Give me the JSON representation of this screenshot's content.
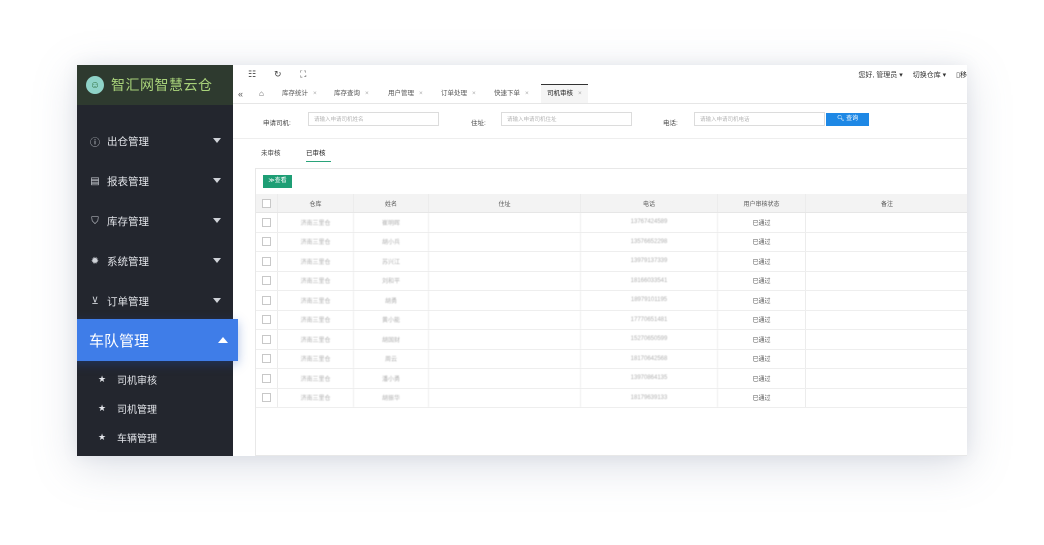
{
  "brand": {
    "name": "智汇网智慧云仓"
  },
  "sidebar": {
    "items": [
      {
        "icon": "info-circle-icon",
        "label": "出仓管理"
      },
      {
        "icon": "report-icon",
        "label": "报表管理"
      },
      {
        "icon": "shield-icon",
        "label": "库存管理"
      },
      {
        "icon": "gear-icon",
        "label": "系统管理"
      },
      {
        "icon": "cart-icon",
        "label": "订单管理"
      }
    ],
    "active": {
      "label": "车队管理"
    },
    "subitems": [
      {
        "icon": "star-icon",
        "label": "司机审核"
      },
      {
        "icon": "star-icon",
        "label": "司机管理"
      },
      {
        "icon": "star-icon",
        "label": "车辆管理"
      }
    ]
  },
  "header": {
    "greeting": "您好, 管理员 ▾",
    "switch_warehouse": "切换仓库 ▾",
    "extra": "▯移"
  },
  "tabs": [
    {
      "label": "库存统计"
    },
    {
      "label": "库存查询"
    },
    {
      "label": "用户管理"
    },
    {
      "label": "订单处理"
    },
    {
      "label": "快速下单"
    },
    {
      "label": "司机审核",
      "active": true
    }
  ],
  "search": {
    "driver_label": "申请司机:",
    "driver_placeholder": "请输入申请司机姓名",
    "address_label": "住址:",
    "address_placeholder": "请输入申请司机住址",
    "phone_label": "电话:",
    "phone_placeholder": "请输入申请司机电话",
    "button": "查询"
  },
  "subtabs": {
    "pending": "未审核",
    "approved": "已审核"
  },
  "view_button": "查看",
  "table": {
    "columns": [
      "仓库",
      "姓名",
      "住址",
      "电话",
      "用户审核状态",
      "备注"
    ],
    "rows": [
      {
        "warehouse": "济南三里仓",
        "name": "崔明晖",
        "address": "",
        "phone": "13767424589",
        "status": "已通过",
        "note": ""
      },
      {
        "warehouse": "济南三里仓",
        "name": "胡小兵",
        "address": "",
        "phone": "13576652298",
        "status": "已通过",
        "note": ""
      },
      {
        "warehouse": "济南三里仓",
        "name": "苏兴江",
        "address": "",
        "phone": "13979137339",
        "status": "已通过",
        "note": ""
      },
      {
        "warehouse": "济南三里仓",
        "name": "刘和平",
        "address": "",
        "phone": "18166033541",
        "status": "已通过",
        "note": ""
      },
      {
        "warehouse": "济南三里仓",
        "name": "胡勇",
        "address": "",
        "phone": "18979101195",
        "status": "已通过",
        "note": ""
      },
      {
        "warehouse": "济南三里仓",
        "name": "黄小能",
        "address": "",
        "phone": "17770651481",
        "status": "已通过",
        "note": ""
      },
      {
        "warehouse": "济南三里仓",
        "name": "胡国财",
        "address": "",
        "phone": "15270650599",
        "status": "已通过",
        "note": ""
      },
      {
        "warehouse": "济南三里仓",
        "name": "周云",
        "address": "",
        "phone": "18170642568",
        "status": "已通过",
        "note": ""
      },
      {
        "warehouse": "济南三里仓",
        "name": "潘小勇",
        "address": "",
        "phone": "13970864135",
        "status": "已通过",
        "note": ""
      },
      {
        "warehouse": "济南三里仓",
        "name": "胡振华",
        "address": "",
        "phone": "18179639133",
        "status": "已通过",
        "note": ""
      }
    ]
  },
  "colors": {
    "accent": "#3f7de8",
    "sidebar_bg": "#23262e",
    "button_blue": "#1e88e5",
    "button_green": "#1e9e75",
    "brand_text": "#a8d27a"
  }
}
